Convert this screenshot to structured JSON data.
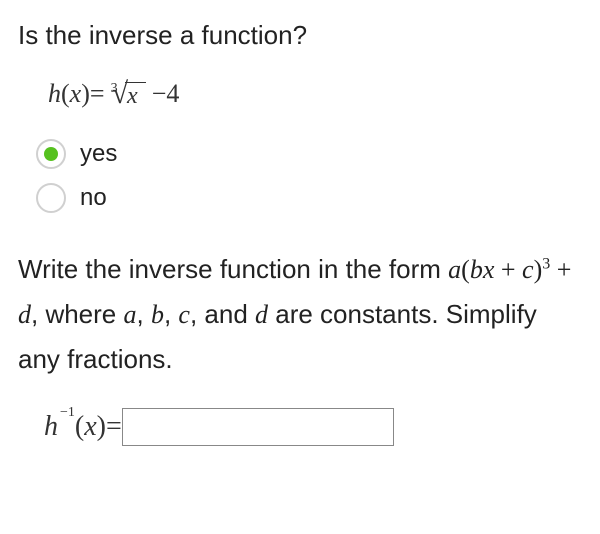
{
  "question1": "Is the inverse a function?",
  "function_def": {
    "lhs_h": "h",
    "lhs_paren_open": "(",
    "lhs_x": "x",
    "lhs_paren_close": ")",
    "equals": " = ",
    "root_index": "3",
    "radical": "√",
    "radicand": "x",
    "minus": " − ",
    "constant": "4"
  },
  "options": {
    "yes": {
      "label": "yes",
      "selected": true
    },
    "no": {
      "label": "no",
      "selected": false
    }
  },
  "question2": {
    "pre": "Write the inverse function in the form ",
    "form_a": "a",
    "form_open": "(",
    "form_bx": "bx",
    "form_plus": " + ",
    "form_c": "c",
    "form_close": ")",
    "form_exp": "3",
    "form_plus2": " + ",
    "form_d": "d",
    "mid": ", where ",
    "var_a": "a",
    "c1": ", ",
    "var_b": "b",
    "c2": ", ",
    "var_c": "c",
    "c3": ", and ",
    "var_d": "d",
    "post": " are constants. Simplify any fractions."
  },
  "answer_line": {
    "h": "h",
    "neg1": "−1",
    "open": "(",
    "x": "x",
    "close": ")",
    "equals": " = ",
    "value": ""
  }
}
